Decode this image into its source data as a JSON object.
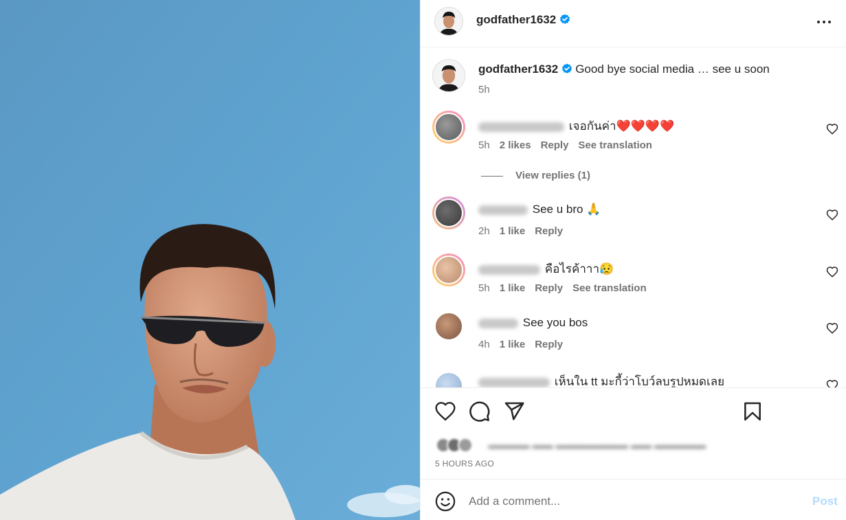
{
  "post": {
    "author": "godfather1632",
    "verified": true,
    "caption": "Good bye social media … see u soon",
    "caption_time": "5h",
    "time_ago": "5 HOURS AGO"
  },
  "comments": [
    {
      "text": "เจอกันค่า❤️❤️❤️❤️",
      "time": "5h",
      "likes": "2 likes",
      "reply": "Reply",
      "translate": "See translation",
      "view_replies": "View replies (1)",
      "avatar_color": "#f2a3c9"
    },
    {
      "text": "See u bro 🙏",
      "time": "2h",
      "likes": "1 like",
      "reply": "Reply",
      "avatar_color": "#e4b3e8"
    },
    {
      "text": "คือไรค้าาา😥",
      "time": "5h",
      "likes": "1 like",
      "reply": "Reply",
      "translate": "See translation",
      "avatar_color": "#f8b27a"
    },
    {
      "text": "See you bos",
      "time": "4h",
      "likes": "1 like",
      "reply": "Reply",
      "avatar_color": "#b5876a"
    },
    {
      "text": "เห็นใน tt มะกี้ว่าโบว์ลบรูปหมดเลย",
      "avatar_color": "#a9c7e8"
    }
  ],
  "actions": {
    "like_icon": "heart-outline-icon",
    "comment_icon": "comment-bubble-icon",
    "share_icon": "paper-plane-icon",
    "save_icon": "bookmark-icon"
  },
  "add_comment": {
    "placeholder": "Add a comment...",
    "post_label": "Post",
    "emoji_icon": "smiley-icon"
  },
  "colors": {
    "verified_blue": "#0095f6",
    "post_button_disabled": "#b3dbff",
    "sky": "#5ea2cf"
  }
}
